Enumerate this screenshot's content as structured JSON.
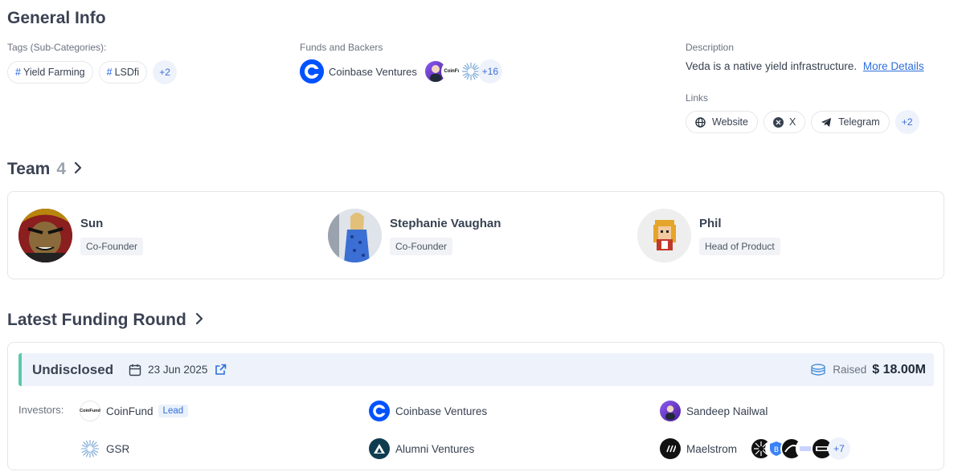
{
  "general": {
    "title": "General Info",
    "tags_label": "Tags (Sub-Categories):",
    "tags": [
      "Yield Farming",
      "LSDfi"
    ],
    "tags_more": "+2",
    "funds_label": "Funds and Backers",
    "funds_primary": "Coinbase Ventures",
    "funds_avatar_text": "CoinFur",
    "funds_more": "+16",
    "description_label": "Description",
    "description_text": "Veda is a native yield infrastructure.",
    "more_details": "More Details",
    "links_label": "Links",
    "links": [
      {
        "label": "Website",
        "icon": "globe-icon"
      },
      {
        "label": "X",
        "icon": "x-icon"
      },
      {
        "label": "Telegram",
        "icon": "telegram-icon"
      }
    ],
    "links_more": "+2"
  },
  "team": {
    "title": "Team",
    "count": "4",
    "members": [
      {
        "name": "Sun",
        "role": "Co-Founder"
      },
      {
        "name": "Stephanie Vaughan",
        "role": "Co-Founder"
      },
      {
        "name": "Phil",
        "role": "Head of Product"
      }
    ]
  },
  "funding": {
    "title": "Latest Funding Round",
    "round_type": "Undisclosed",
    "date": "23 Jun 2025",
    "raised_label": "Raised",
    "raised_amount": "$ 18.00M",
    "investors_label": "Investors:",
    "investors": [
      {
        "name": "CoinFund",
        "lead": "Lead",
        "logo_text": "CoinFund"
      },
      {
        "name": "Coinbase Ventures"
      },
      {
        "name": "Sandeep Nailwal"
      },
      {
        "name": "GSR"
      },
      {
        "name": "Alumni Ventures"
      },
      {
        "name": "Maelstrom"
      }
    ],
    "investors_more": "+7"
  },
  "colors": {
    "accent": "#2f6fdb",
    "coinbase_blue": "#0052ff",
    "round_bar": "#5cc9a7",
    "round_bg": "#eef3fb"
  }
}
